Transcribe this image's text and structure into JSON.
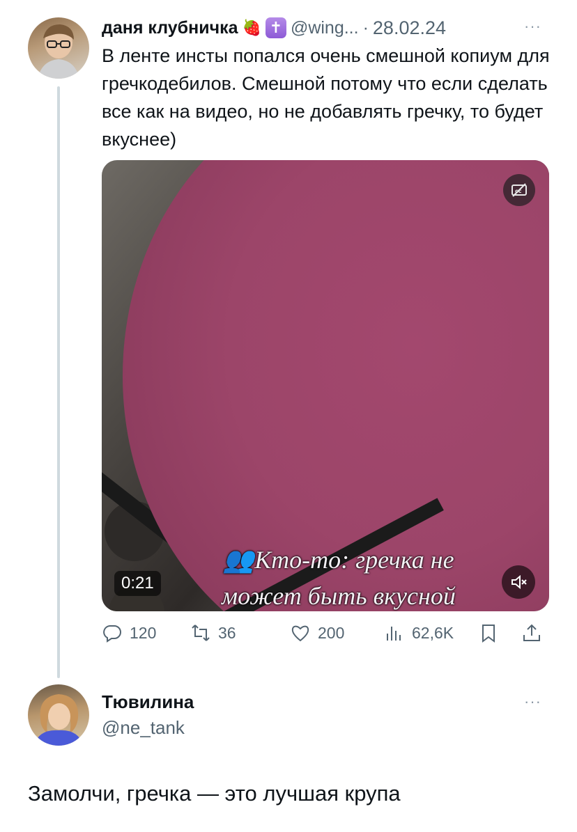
{
  "tweet": {
    "author_name": "даня клубничка",
    "author_emoji": "🍓",
    "badge_symbol": "✝",
    "handle": "@wing...",
    "separator": "·",
    "date": "28.02.24",
    "more_label": "···",
    "text": "В ленте инсты попался очень смешной копиум для гречкодебилов. Смешной потому что если сделать все как на видео, но не добавлять гречку, то будет вкуснее)",
    "video": {
      "caption_line1": "👥Кто-то: гречка не",
      "caption_line2": "может быть вкусной",
      "duration": "0:21",
      "cc_icon": "cc-off-icon",
      "mute_icon": "muted-icon"
    },
    "actions": {
      "replies": "120",
      "retweets": "36",
      "likes": "200",
      "views": "62,6K"
    }
  },
  "reply": {
    "author_name": "Тювилина",
    "handle": "@ne_tank",
    "more_label": "···",
    "text": "Замолчи, гречка — это лучшая крупа"
  },
  "colors": {
    "text_primary": "#0f1419",
    "text_secondary": "#536471",
    "thread_line": "#cfd9de",
    "pan": "#9c4569"
  }
}
